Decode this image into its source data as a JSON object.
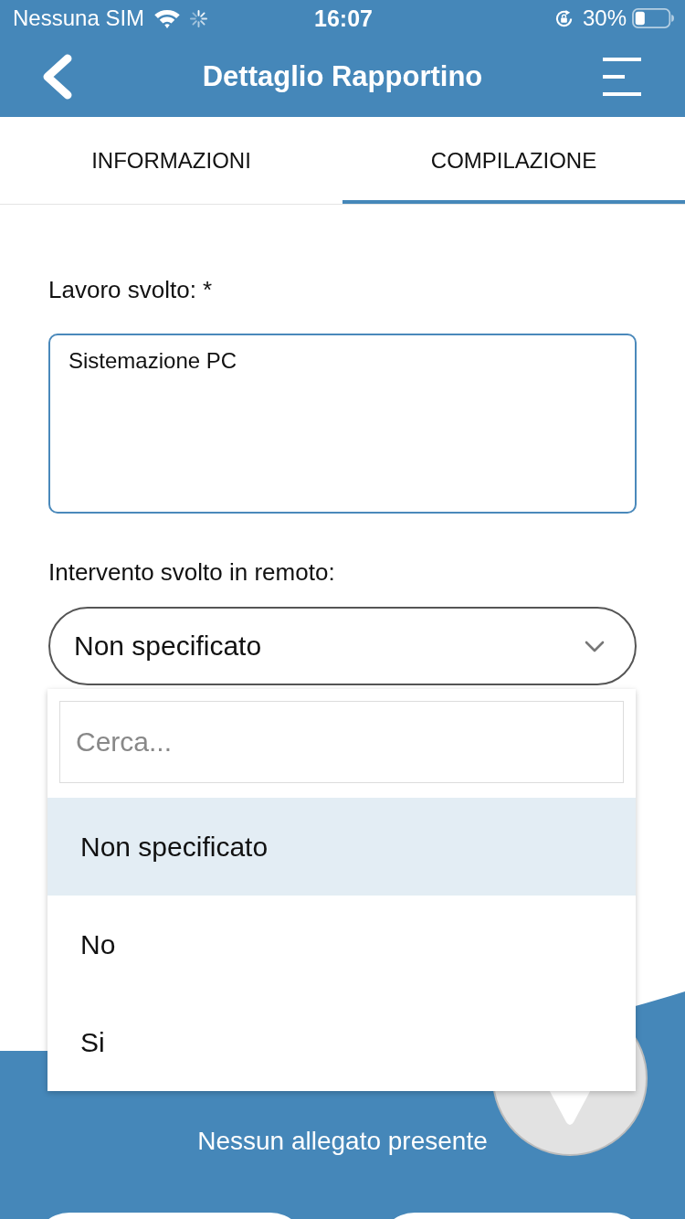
{
  "status_bar": {
    "carrier": "Nessuna SIM",
    "time": "16:07",
    "battery": "30%"
  },
  "header": {
    "title": "Dettaglio Rapportino"
  },
  "tabs": [
    {
      "label": "INFORMAZIONI",
      "selected": false
    },
    {
      "label": "COMPILAZIONE",
      "selected": true
    }
  ],
  "form": {
    "fields": [
      {
        "kind": "textarea",
        "label": "Lavoro svolto: *",
        "value": "Sistemazione PC"
      },
      {
        "kind": "select",
        "label": "Intervento svolto in remoto:",
        "value": "Non specificato",
        "expanded": true,
        "search_placeholder": "Cerca...",
        "options": [
          {
            "label": "Non specificato",
            "selected": true
          },
          {
            "label": "No",
            "selected": false
          },
          {
            "label": "Si",
            "selected": false
          }
        ]
      }
    ]
  },
  "attachments": {
    "empty_text": "Nessun allegato presente"
  }
}
